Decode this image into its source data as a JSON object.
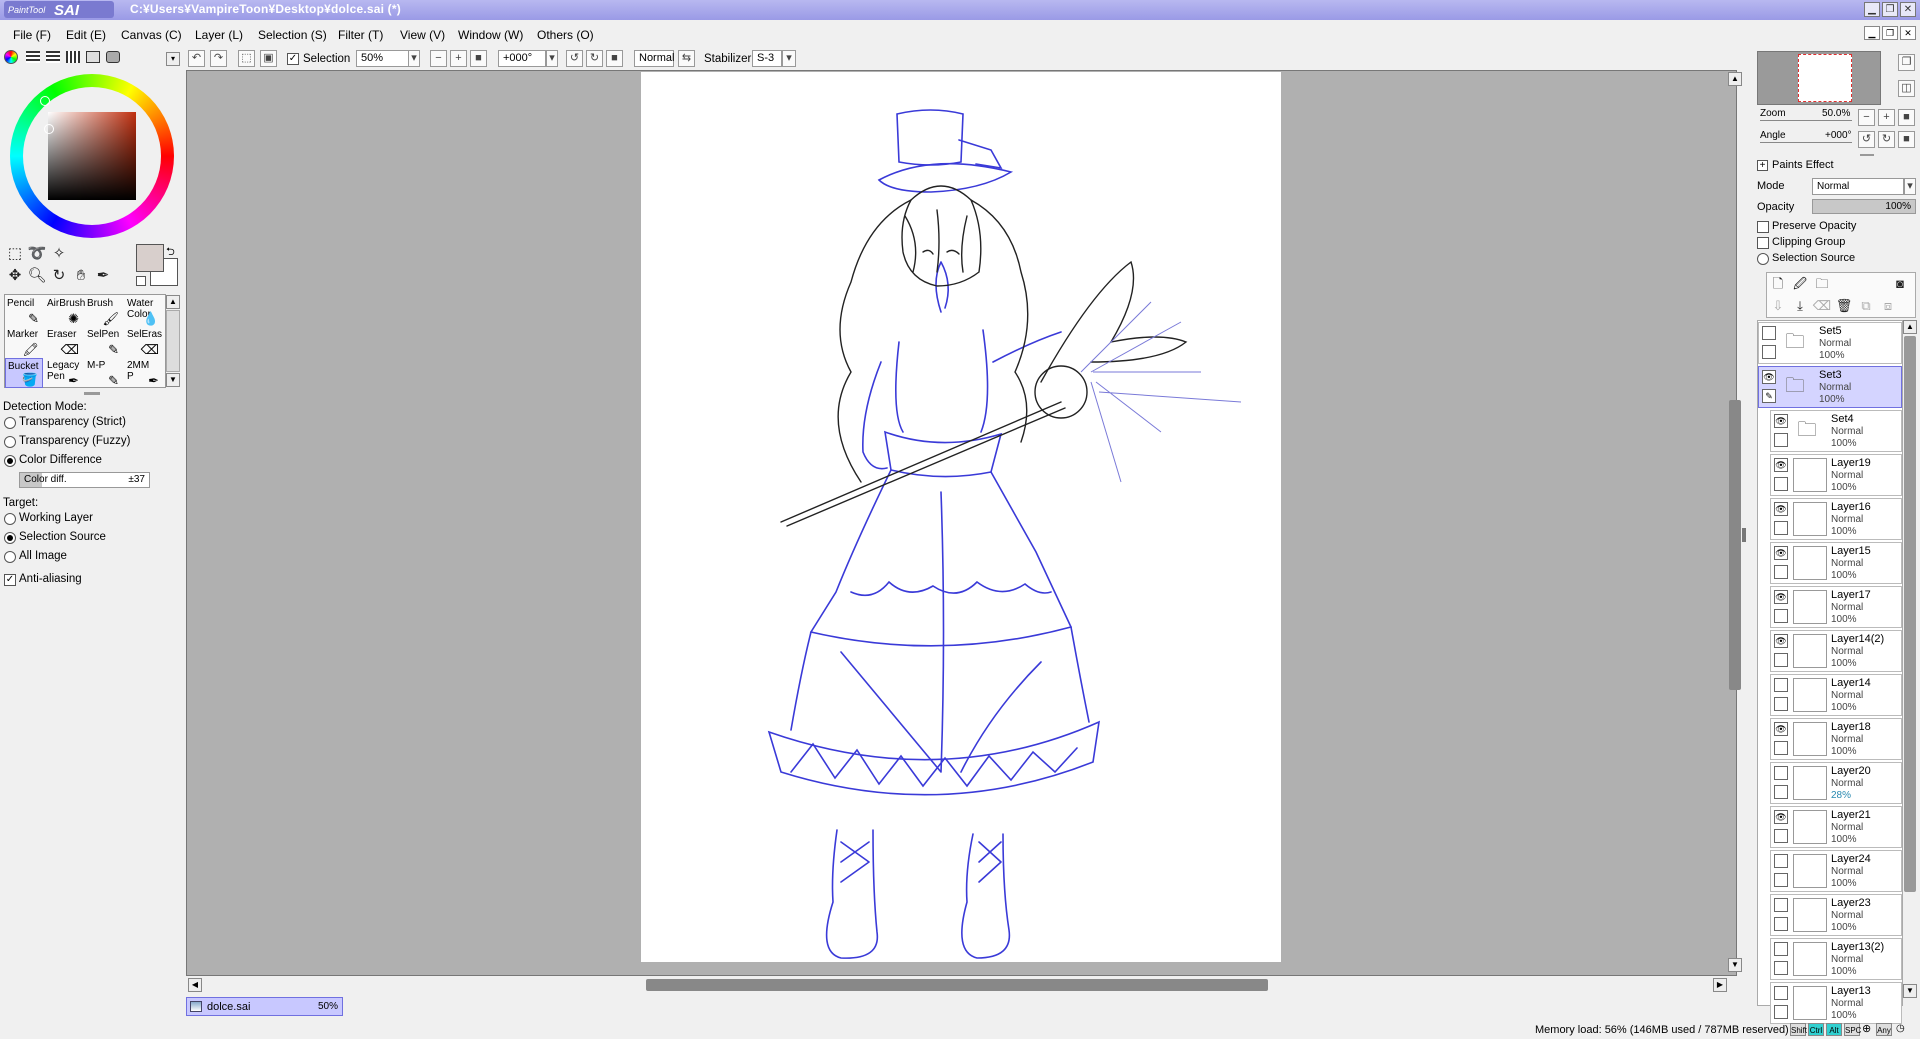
{
  "app": {
    "logo_text": "PaintTool SAI",
    "title": "C:¥Users¥VampireToon¥Desktop¥dolce.sai (*)"
  },
  "menu": [
    "File (F)",
    "Edit (E)",
    "Canvas (C)",
    "Layer (L)",
    "Selection (S)",
    "Filter (T)",
    "View (V)",
    "Window (W)",
    "Others (O)"
  ],
  "toolbar": {
    "selection_label": "Selection",
    "zoom_value": "50%",
    "angle_value": "+000°",
    "blend_value": "Normal",
    "stabilizer_label": "Stabilizer",
    "stabilizer_value": "S-3"
  },
  "tools": {
    "brushes": [
      {
        "label": "Pencil"
      },
      {
        "label": "AirBrush"
      },
      {
        "label": "Brush"
      },
      {
        "label": "Water Color"
      },
      {
        "label": "Marker"
      },
      {
        "label": "Eraser"
      },
      {
        "label": "SelPen"
      },
      {
        "label": "SelEras"
      },
      {
        "label": "Bucket"
      },
      {
        "label": "Legacy Pen"
      },
      {
        "label": "M-P"
      },
      {
        "label": "2MM P"
      }
    ],
    "selected_brush": "Bucket",
    "detection_mode_label": "Detection Mode:",
    "detection_modes": [
      "Transparency (Strict)",
      "Transparency (Fuzzy)",
      "Color Difference"
    ],
    "selected_detection_mode": "Color Difference",
    "color_diff_label": "Color diff.",
    "color_diff_value": "±37",
    "target_label": "Target:",
    "targets": [
      "Working Layer",
      "Selection Source",
      "All Image"
    ],
    "selected_target": "Selection Source",
    "antialiasing_label": "Anti-aliasing"
  },
  "document_tab": {
    "name": "dolce.sai",
    "zoom": "50%"
  },
  "navigator": {
    "zoom_label": "Zoom",
    "zoom_value": "50.0%",
    "angle_label": "Angle",
    "angle_value": "+000°"
  },
  "layer_props": {
    "paints_effect": "Paints Effect",
    "mode_label": "Mode",
    "mode_value": "Normal",
    "opacity_label": "Opacity",
    "opacity_value": "100%",
    "preserve_opacity": "Preserve Opacity",
    "clipping_group": "Clipping Group",
    "selection_source": "Selection Source"
  },
  "layers": [
    {
      "name": "Set5",
      "mode": "Normal",
      "opacity": "100%",
      "folder": true,
      "visible": false,
      "selected": false,
      "indent": false
    },
    {
      "name": "Set3",
      "mode": "Normal",
      "opacity": "100%",
      "folder": true,
      "visible": true,
      "selected": true,
      "indent": false
    },
    {
      "name": "Set4",
      "mode": "Normal",
      "opacity": "100%",
      "folder": true,
      "visible": true,
      "selected": false,
      "indent": true
    },
    {
      "name": "Layer19",
      "mode": "Normal",
      "opacity": "100%",
      "folder": false,
      "visible": true,
      "selected": false,
      "indent": true
    },
    {
      "name": "Layer16",
      "mode": "Normal",
      "opacity": "100%",
      "folder": false,
      "visible": true,
      "selected": false,
      "indent": true
    },
    {
      "name": "Layer15",
      "mode": "Normal",
      "opacity": "100%",
      "folder": false,
      "visible": true,
      "selected": false,
      "indent": true
    },
    {
      "name": "Layer17",
      "mode": "Normal",
      "opacity": "100%",
      "folder": false,
      "visible": true,
      "selected": false,
      "indent": true
    },
    {
      "name": "Layer14(2)",
      "mode": "Normal",
      "opacity": "100%",
      "folder": false,
      "visible": true,
      "selected": false,
      "indent": true
    },
    {
      "name": "Layer14",
      "mode": "Normal",
      "opacity": "100%",
      "folder": false,
      "visible": false,
      "selected": false,
      "indent": true
    },
    {
      "name": "Layer18",
      "mode": "Normal",
      "opacity": "100%",
      "folder": false,
      "visible": true,
      "selected": false,
      "indent": true
    },
    {
      "name": "Layer20",
      "mode": "Normal",
      "opacity": "28%",
      "folder": false,
      "visible": false,
      "selected": false,
      "indent": true
    },
    {
      "name": "Layer21",
      "mode": "Normal",
      "opacity": "100%",
      "folder": false,
      "visible": true,
      "selected": false,
      "indent": true
    },
    {
      "name": "Layer24",
      "mode": "Normal",
      "opacity": "100%",
      "folder": false,
      "visible": false,
      "selected": false,
      "indent": true
    },
    {
      "name": "Layer23",
      "mode": "Normal",
      "opacity": "100%",
      "folder": false,
      "visible": false,
      "selected": false,
      "indent": true
    },
    {
      "name": "Layer13(2)",
      "mode": "Normal",
      "opacity": "100%",
      "folder": false,
      "visible": false,
      "selected": false,
      "indent": true
    },
    {
      "name": "Layer13",
      "mode": "Normal",
      "opacity": "100%",
      "folder": false,
      "visible": false,
      "selected": false,
      "indent": true
    }
  ],
  "status": {
    "memory": "Memory load: 56% (146MB used / 787MB reserved)",
    "keys": [
      "Shift",
      "Ctrl",
      "Alt",
      "SPC",
      "Any"
    ]
  },
  "colors": {
    "titlebar": "#a8a8ea",
    "selection_highlight": "#d4d4ff",
    "sketch_blue": "#3a3ad8",
    "canvas_bg": "#b0b0b0"
  }
}
